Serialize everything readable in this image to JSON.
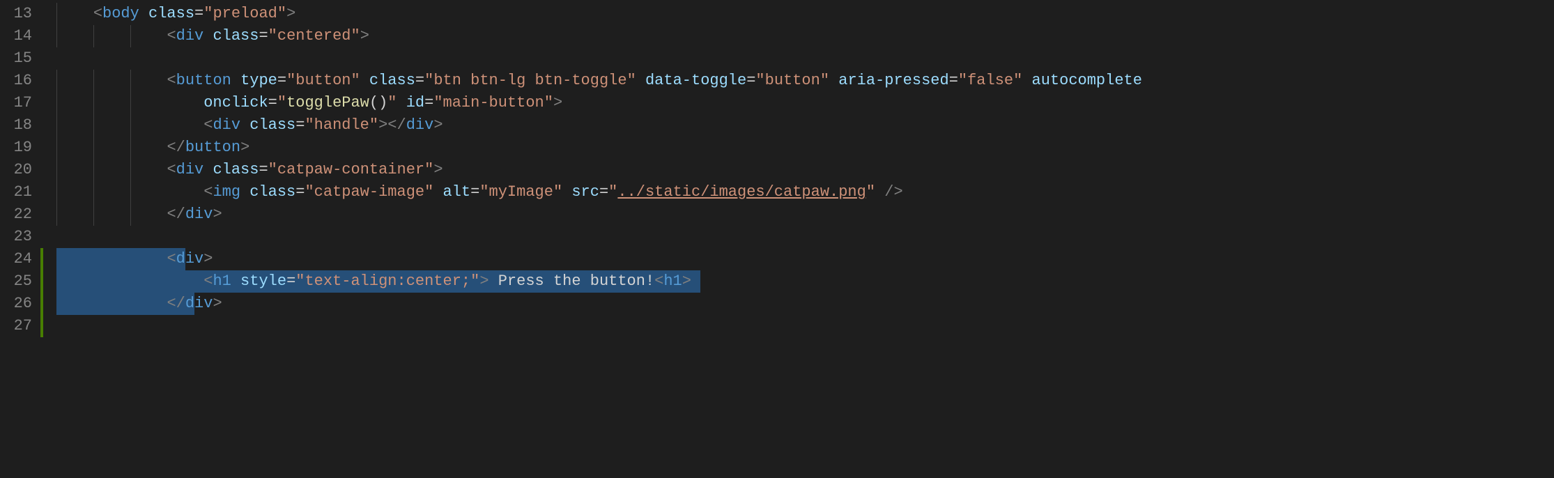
{
  "gutter": {
    "start": 13,
    "end": 27,
    "modified": [
      24,
      25,
      26,
      27
    ]
  },
  "code": {
    "l13": {
      "indent": 1,
      "tokens": [
        {
          "c": "brk",
          "t": "<"
        },
        {
          "c": "tag",
          "t": "body"
        },
        {
          "c": "txt",
          "t": " "
        },
        {
          "c": "attr",
          "t": "class"
        },
        {
          "c": "txt",
          "t": "="
        },
        {
          "c": "str",
          "t": "\"preload\""
        },
        {
          "c": "brk",
          "t": ">"
        }
      ]
    },
    "l14": {
      "indent": 3,
      "tokens": [
        {
          "c": "brk",
          "t": "<"
        },
        {
          "c": "tag",
          "t": "div"
        },
        {
          "c": "txt",
          "t": " "
        },
        {
          "c": "attr",
          "t": "class"
        },
        {
          "c": "txt",
          "t": "="
        },
        {
          "c": "str",
          "t": "\"centered\""
        },
        {
          "c": "brk",
          "t": ">"
        }
      ]
    },
    "l15": {
      "indent": 0,
      "tokens": []
    },
    "l16": {
      "indent": 3,
      "tokens": [
        {
          "c": "brk",
          "t": "<"
        },
        {
          "c": "tag",
          "t": "button"
        },
        {
          "c": "txt",
          "t": " "
        },
        {
          "c": "attr",
          "t": "type"
        },
        {
          "c": "txt",
          "t": "="
        },
        {
          "c": "str",
          "t": "\"button\""
        },
        {
          "c": "txt",
          "t": " "
        },
        {
          "c": "attr",
          "t": "class"
        },
        {
          "c": "txt",
          "t": "="
        },
        {
          "c": "str",
          "t": "\"btn btn-lg btn-toggle\""
        },
        {
          "c": "txt",
          "t": " "
        },
        {
          "c": "attr",
          "t": "data-toggle"
        },
        {
          "c": "txt",
          "t": "="
        },
        {
          "c": "str",
          "t": "\"button\""
        },
        {
          "c": "txt",
          "t": " "
        },
        {
          "c": "attr",
          "t": "aria-pressed"
        },
        {
          "c": "txt",
          "t": "="
        },
        {
          "c": "str",
          "t": "\"false\""
        },
        {
          "c": "txt",
          "t": " "
        },
        {
          "c": "attr",
          "t": "autocomplete"
        }
      ]
    },
    "l17": {
      "indent": 4,
      "tokens": [
        {
          "c": "attr",
          "t": "onclick"
        },
        {
          "c": "txt",
          "t": "="
        },
        {
          "c": "str",
          "t": "\""
        },
        {
          "c": "fn",
          "t": "togglePaw"
        },
        {
          "c": "txt",
          "t": "()"
        },
        {
          "c": "str",
          "t": "\""
        },
        {
          "c": "txt",
          "t": " "
        },
        {
          "c": "attr",
          "t": "id"
        },
        {
          "c": "txt",
          "t": "="
        },
        {
          "c": "str",
          "t": "\"main-button\""
        },
        {
          "c": "brk",
          "t": ">"
        }
      ]
    },
    "l18": {
      "indent": 4,
      "tokens": [
        {
          "c": "brk",
          "t": "<"
        },
        {
          "c": "tag",
          "t": "div"
        },
        {
          "c": "txt",
          "t": " "
        },
        {
          "c": "attr",
          "t": "class"
        },
        {
          "c": "txt",
          "t": "="
        },
        {
          "c": "str",
          "t": "\"handle\""
        },
        {
          "c": "brk",
          "t": "></"
        },
        {
          "c": "tag",
          "t": "div"
        },
        {
          "c": "brk",
          "t": ">"
        }
      ]
    },
    "l19": {
      "indent": 3,
      "tokens": [
        {
          "c": "brk",
          "t": "</"
        },
        {
          "c": "tag",
          "t": "button"
        },
        {
          "c": "brk",
          "t": ">"
        }
      ]
    },
    "l20": {
      "indent": 3,
      "tokens": [
        {
          "c": "brk",
          "t": "<"
        },
        {
          "c": "tag",
          "t": "div"
        },
        {
          "c": "txt",
          "t": " "
        },
        {
          "c": "attr",
          "t": "class"
        },
        {
          "c": "txt",
          "t": "="
        },
        {
          "c": "str",
          "t": "\"catpaw-container\""
        },
        {
          "c": "brk",
          "t": ">"
        }
      ]
    },
    "l21": {
      "indent": 4,
      "tokens": [
        {
          "c": "brk",
          "t": "<"
        },
        {
          "c": "tag",
          "t": "img"
        },
        {
          "c": "txt",
          "t": " "
        },
        {
          "c": "attr",
          "t": "class"
        },
        {
          "c": "txt",
          "t": "="
        },
        {
          "c": "str",
          "t": "\"catpaw-image\""
        },
        {
          "c": "txt",
          "t": " "
        },
        {
          "c": "attr",
          "t": "alt"
        },
        {
          "c": "txt",
          "t": "="
        },
        {
          "c": "str",
          "t": "\"myImage\""
        },
        {
          "c": "txt",
          "t": " "
        },
        {
          "c": "attr",
          "t": "src"
        },
        {
          "c": "txt",
          "t": "="
        },
        {
          "c": "str",
          "t": "\""
        },
        {
          "c": "str-u",
          "t": "../static/images/catpaw.png"
        },
        {
          "c": "str",
          "t": "\""
        },
        {
          "c": "txt",
          "t": " "
        },
        {
          "c": "brk",
          "t": "/>"
        }
      ]
    },
    "l22": {
      "indent": 3,
      "tokens": [
        {
          "c": "brk",
          "t": "</"
        },
        {
          "c": "tag",
          "t": "div"
        },
        {
          "c": "brk",
          "t": ">"
        }
      ]
    },
    "l23": {
      "indent": 0,
      "tokens": []
    },
    "l24": {
      "indent": 3,
      "selection": {
        "from": 0,
        "to": 14
      },
      "tokens": [
        {
          "c": "brk",
          "t": "<"
        },
        {
          "c": "tag",
          "t": "div"
        },
        {
          "c": "brk",
          "t": ">"
        }
      ]
    },
    "l25": {
      "indent": 4,
      "selection": {
        "from": 0,
        "to": 70
      },
      "tokens": [
        {
          "c": "brk",
          "t": "<"
        },
        {
          "c": "tag",
          "t": "h1"
        },
        {
          "c": "txt",
          "t": " "
        },
        {
          "c": "attr",
          "t": "style"
        },
        {
          "c": "txt",
          "t": "="
        },
        {
          "c": "str",
          "t": "\"text-align:center;\""
        },
        {
          "c": "brk",
          "t": ">"
        },
        {
          "c": "txt",
          "t": " Press the button!"
        },
        {
          "c": "brk",
          "t": "<"
        },
        {
          "c": "tag",
          "t": "h1"
        },
        {
          "c": "brk",
          "t": ">"
        }
      ]
    },
    "l26": {
      "indent": 3,
      "selection": {
        "from": 0,
        "to": 15
      },
      "tokens": [
        {
          "c": "brk",
          "t": "</"
        },
        {
          "c": "tag",
          "t": "div"
        },
        {
          "c": "brk",
          "t": ">"
        }
      ]
    },
    "l27": {
      "indent": 0,
      "tokens": []
    }
  },
  "layout": {
    "charWidth": 13.2,
    "indentUnit": 4,
    "indentGuideColumns": [
      0,
      4,
      8
    ]
  }
}
